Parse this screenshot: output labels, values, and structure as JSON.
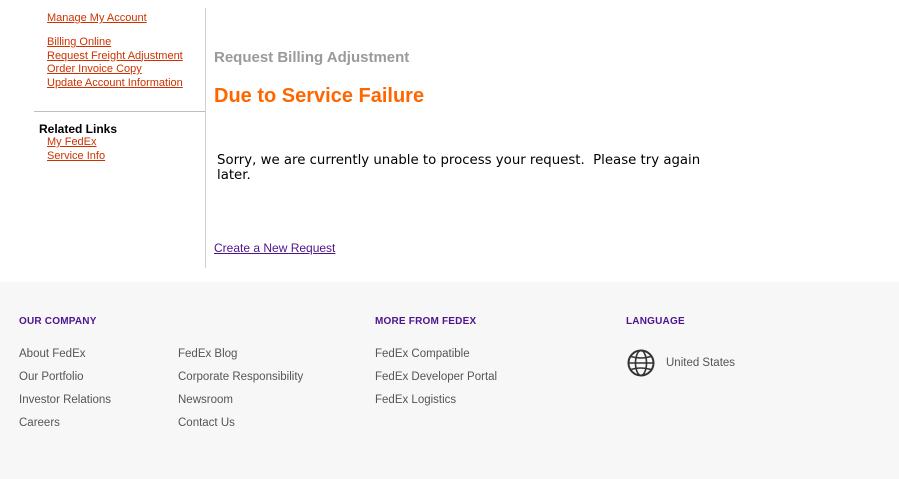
{
  "sidebar": {
    "top_link": "Manage My Account",
    "billing_links": [
      "Billing Online",
      "Request Freight Adjustment",
      "Order Invoice Copy",
      "Update Account Information"
    ],
    "related_title": "Related Links",
    "related_links": [
      "My FedEx",
      "Service Info"
    ]
  },
  "main": {
    "heading": "Request Billing Adjustment",
    "title": "Due to Service Failure",
    "message_line1": "Sorry, we are currently unable to process your request.  Please try again",
    "message_line2": "later.",
    "new_request_link": "Create a New Request"
  },
  "footer": {
    "company": {
      "heading": "OUR COMPANY",
      "col1": [
        "About FedEx",
        "Our Portfolio",
        "Investor Relations",
        "Careers"
      ],
      "col2": [
        "FedEx Blog",
        "Corporate Responsibility",
        "Newsroom",
        "Contact Us"
      ]
    },
    "more": {
      "heading": "MORE FROM FEDEX",
      "links": [
        "FedEx Compatible",
        "FedEx Developer Portal",
        "FedEx Logistics"
      ]
    },
    "language": {
      "heading": "LANGUAGE",
      "icon": "globe-icon",
      "value": "United States"
    }
  },
  "colors": {
    "sidebar_link": "#cc3300",
    "title_orange": "#ff6600",
    "fedex_purple": "#4d148c",
    "heading_gray": "#9a9a9a",
    "footer_bg": "#f7f7f7"
  }
}
